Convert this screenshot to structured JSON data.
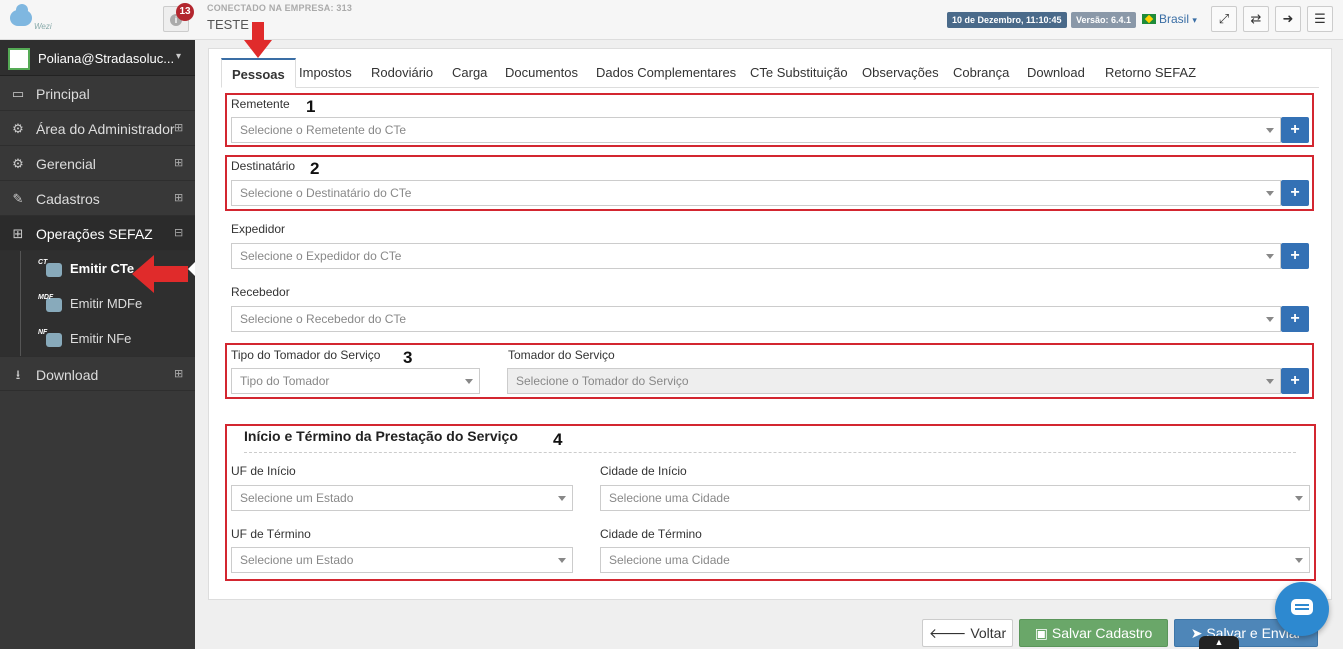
{
  "header": {
    "notifications_count": "13",
    "company_line": "CONECTADO NA EMPRESA: 313",
    "company_name": "TESTE",
    "datetime": "10 de Dezembro, 11:10:45",
    "version": "Versão: 6.4.1",
    "language": "Brasil",
    "logo_text": "Wezi"
  },
  "sidebar": {
    "user": "Poliana@Stradasoluc...",
    "items": [
      {
        "label": "Principal",
        "icon": "laptop-icon"
      },
      {
        "label": "Área do Administrador",
        "icon": "gears-icon",
        "toggle": "⊞"
      },
      {
        "label": "Gerencial",
        "icon": "gears-icon",
        "toggle": "⊞"
      },
      {
        "label": "Cadastros",
        "icon": "edit-icon",
        "toggle": "⊞"
      },
      {
        "label": "Operações SEFAZ",
        "icon": "windows-icon",
        "toggle": "⊟"
      }
    ],
    "sub_items": [
      {
        "label": "Emitir CTe",
        "tag": "CT"
      },
      {
        "label": "Emitir MDFe",
        "tag": "MDF"
      },
      {
        "label": "Emitir NFe",
        "tag": "NF"
      }
    ],
    "download": {
      "label": "Download",
      "toggle": "⊞"
    }
  },
  "tabs": [
    "Pessoas",
    "Impostos",
    "Rodoviário",
    "Carga",
    "Documentos",
    "Dados Complementares",
    "CTe Substituição",
    "Observações",
    "Cobrança",
    "Download",
    "Retorno SEFAZ"
  ],
  "form": {
    "remetente": {
      "label": "Remetente",
      "placeholder": "Selecione o Remetente do CTe"
    },
    "destinatario": {
      "label": "Destinatário",
      "placeholder": "Selecione o Destinatário do CTe"
    },
    "expedidor": {
      "label": "Expedidor",
      "placeholder": "Selecione o Expedidor do CTe"
    },
    "recebedor": {
      "label": "Recebedor",
      "placeholder": "Selecione o Recebedor do CTe"
    },
    "tipo_tomador": {
      "label": "Tipo do Tomador do Serviço",
      "placeholder": "Tipo do Tomador"
    },
    "tomador": {
      "label": "Tomador do Serviço",
      "placeholder": "Selecione o Tomador do Serviço"
    },
    "prestacao": {
      "title": "Início e Término da Prestação do Serviço",
      "uf_inicio": {
        "label": "UF de Início",
        "placeholder": "Selecione um Estado"
      },
      "cidade_inicio": {
        "label": "Cidade de Início",
        "placeholder": "Selecione uma Cidade"
      },
      "uf_termino": {
        "label": "UF de Término",
        "placeholder": "Selecione um Estado"
      },
      "cidade_termino": {
        "label": "Cidade de Término",
        "placeholder": "Selecione uma Cidade"
      }
    },
    "plus": "+"
  },
  "annotations": {
    "n1": "1",
    "n2": "2",
    "n3": "3",
    "n4": "4"
  },
  "buttons": {
    "back": "Voltar",
    "save": "Salvar Cadastro",
    "send": "Salvar e Enviar"
  },
  "colors": {
    "accent": "#3471b5",
    "annotation_red": "#d32630",
    "save_green": "#6aa769"
  }
}
